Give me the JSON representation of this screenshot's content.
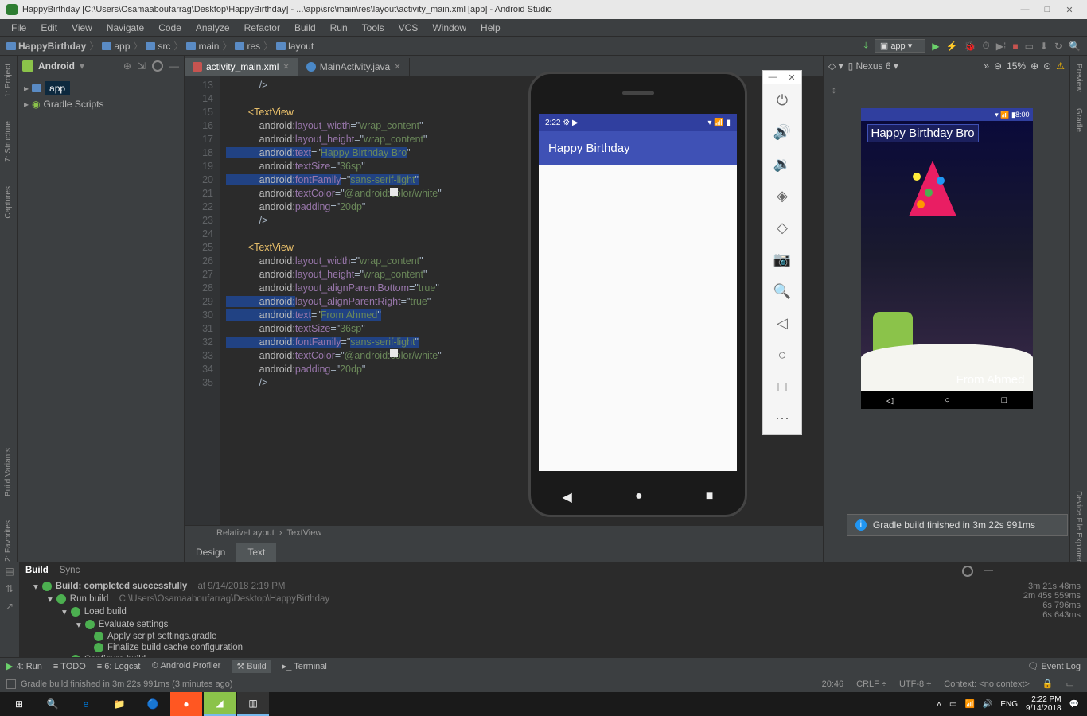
{
  "title": "HappyBirthday [C:\\Users\\Osamaaboufarrag\\Desktop\\HappyBirthday] - ...\\app\\src\\main\\res\\layout\\activity_main.xml [app] - Android Studio",
  "menu": [
    "File",
    "Edit",
    "View",
    "Navigate",
    "Code",
    "Analyze",
    "Refactor",
    "Build",
    "Run",
    "Tools",
    "VCS",
    "Window",
    "Help"
  ],
  "crumbs": [
    "HappyBirthday",
    "app",
    "src",
    "main",
    "res",
    "layout"
  ],
  "runConfig": "app",
  "projectView": "Android",
  "tree": {
    "app": "app",
    "gradle": "Gradle Scripts"
  },
  "tabs": [
    {
      "label": "activity_main.xml",
      "active": true,
      "type": "xml"
    },
    {
      "label": "MainActivity.java",
      "active": false,
      "type": "java"
    }
  ],
  "lines": [
    "13",
    "14",
    "15",
    "16",
    "17",
    "18",
    "19",
    "20",
    "21",
    "22",
    "23",
    "24",
    "25",
    "26",
    "27",
    "28",
    "29",
    "30",
    "31",
    "32",
    "33",
    "34",
    "35"
  ],
  "code": {
    "l13": "            />",
    "l15": "        <TextView",
    "l16a": "            android:",
    "l16b": "layout_width",
    "l16c": "=\"",
    "l16d": "wrap_content",
    "l16e": "\"",
    "l17a": "            android:",
    "l17b": "layout_height",
    "l17c": "=\"",
    "l17d": "wrap_content",
    "l17e": "\"",
    "l18a": "            android:",
    "l18b": "text",
    "l18c": "=\"",
    "l18d": "Happy Birthday Bro",
    "l18e": "\"",
    "l19a": "            android:",
    "l19b": "textSize",
    "l19c": "=\"",
    "l19d": "36sp",
    "l19e": "\"",
    "l20a": "            android:",
    "l20b": "fontFamily",
    "l20c": "=\"",
    "l20d": "sans-serif-light",
    "l20e": "\"",
    "l21a": "            android:",
    "l21b": "textColor",
    "l21c": "=\"",
    "l21d": "@android:color/white",
    "l21e": "\"",
    "l22a": "            android:",
    "l22b": "padding",
    "l22c": "=\"",
    "l22d": "20dp",
    "l22e": "\"",
    "l23": "            />",
    "l25": "        <TextView",
    "l26a": "            android:",
    "l26b": "layout_width",
    "l26c": "=\"",
    "l26d": "wrap_content",
    "l26e": "\"",
    "l27a": "            android:",
    "l27b": "layout_height",
    "l27c": "=\"",
    "l27d": "wrap_content",
    "l27e": "\"",
    "l28a": "            android:",
    "l28b": "layout_alignParentBottom",
    "l28c": "=\"",
    "l28d": "true",
    "l28e": "\"",
    "l29a": "            android:",
    "l29b": "layout_alignParentRight",
    "l29c": "=\"",
    "l29d": "true",
    "l29e": "\"",
    "l30a": "            android:",
    "l30b": "text",
    "l30c": "=\"",
    "l30d": "From Ahmed",
    "l30e": "\"",
    "l31a": "            android:",
    "l31b": "textSize",
    "l31c": "=\"",
    "l31d": "36sp",
    "l31e": "\"",
    "l32a": "            android:",
    "l32b": "fontFamily",
    "l32c": "=\"",
    "l32d": "sans-serif-light",
    "l32e": "\"",
    "l33a": "            android:",
    "l33b": "textColor",
    "l33c": "=\"",
    "l33d": "@android:color/white",
    "l33e": "\"",
    "l34a": "            android:",
    "l34b": "padding",
    "l34c": "=\"",
    "l34d": "20dp",
    "l34e": "\"",
    "l35": "            />"
  },
  "crumb2a": "RelativeLayout",
  "crumb2b": "TextView",
  "designTabs": {
    "design": "Design",
    "text": "Text"
  },
  "emulator": {
    "time": "2:22",
    "appTitle": "Happy Birthday"
  },
  "preview": {
    "device": "Nexus 6",
    "zoom": "15%",
    "status": "8:00",
    "t1": "Happy Birthday Bro",
    "t2": "From Ahmed"
  },
  "build": {
    "tabs": {
      "b": "Build",
      "s": "Sync"
    },
    "root": "Build: completed successfully",
    "rootT": "at 9/14/2018 2:19 PM",
    "n1": "Run build",
    "n1p": "C:\\Users\\Osamaaboufarrag\\Desktop\\HappyBirthday",
    "n2": "Load build",
    "n3": "Evaluate settings",
    "n4": "Apply script settings.gradle",
    "n5": "Finalize build cache configuration",
    "n6": "Configure build",
    "t1": "3m 21s 48ms",
    "t2": "2m 45s 559ms",
    "t3": "6s 796ms",
    "t4": "6s 643ms"
  },
  "toast": "Gradle build finished in 3m 22s 991ms",
  "bottomBar": {
    "run": "4: Run",
    "todo": "TODO",
    "logcat": "6: Logcat",
    "prof": "Android Profiler",
    "build": "Build",
    "term": "Terminal",
    "event": "Event Log"
  },
  "status": {
    "msg": "Gradle build finished in 3m 22s 991ms (3 minutes ago)",
    "time": "20:46",
    "crlf": "CRLF",
    "enc": "UTF-8",
    "ctx": "Context: <no context>"
  },
  "leftRail": [
    "1: Project",
    "7: Structure",
    "Captures",
    "Build Variants",
    "2: Favorites"
  ],
  "rightRail": [
    "Preview",
    "Gradle",
    "Device File Explorer"
  ],
  "taskbar": {
    "lang": "ENG",
    "clock1": "2:22 PM",
    "clock2": "9/14/2018"
  }
}
